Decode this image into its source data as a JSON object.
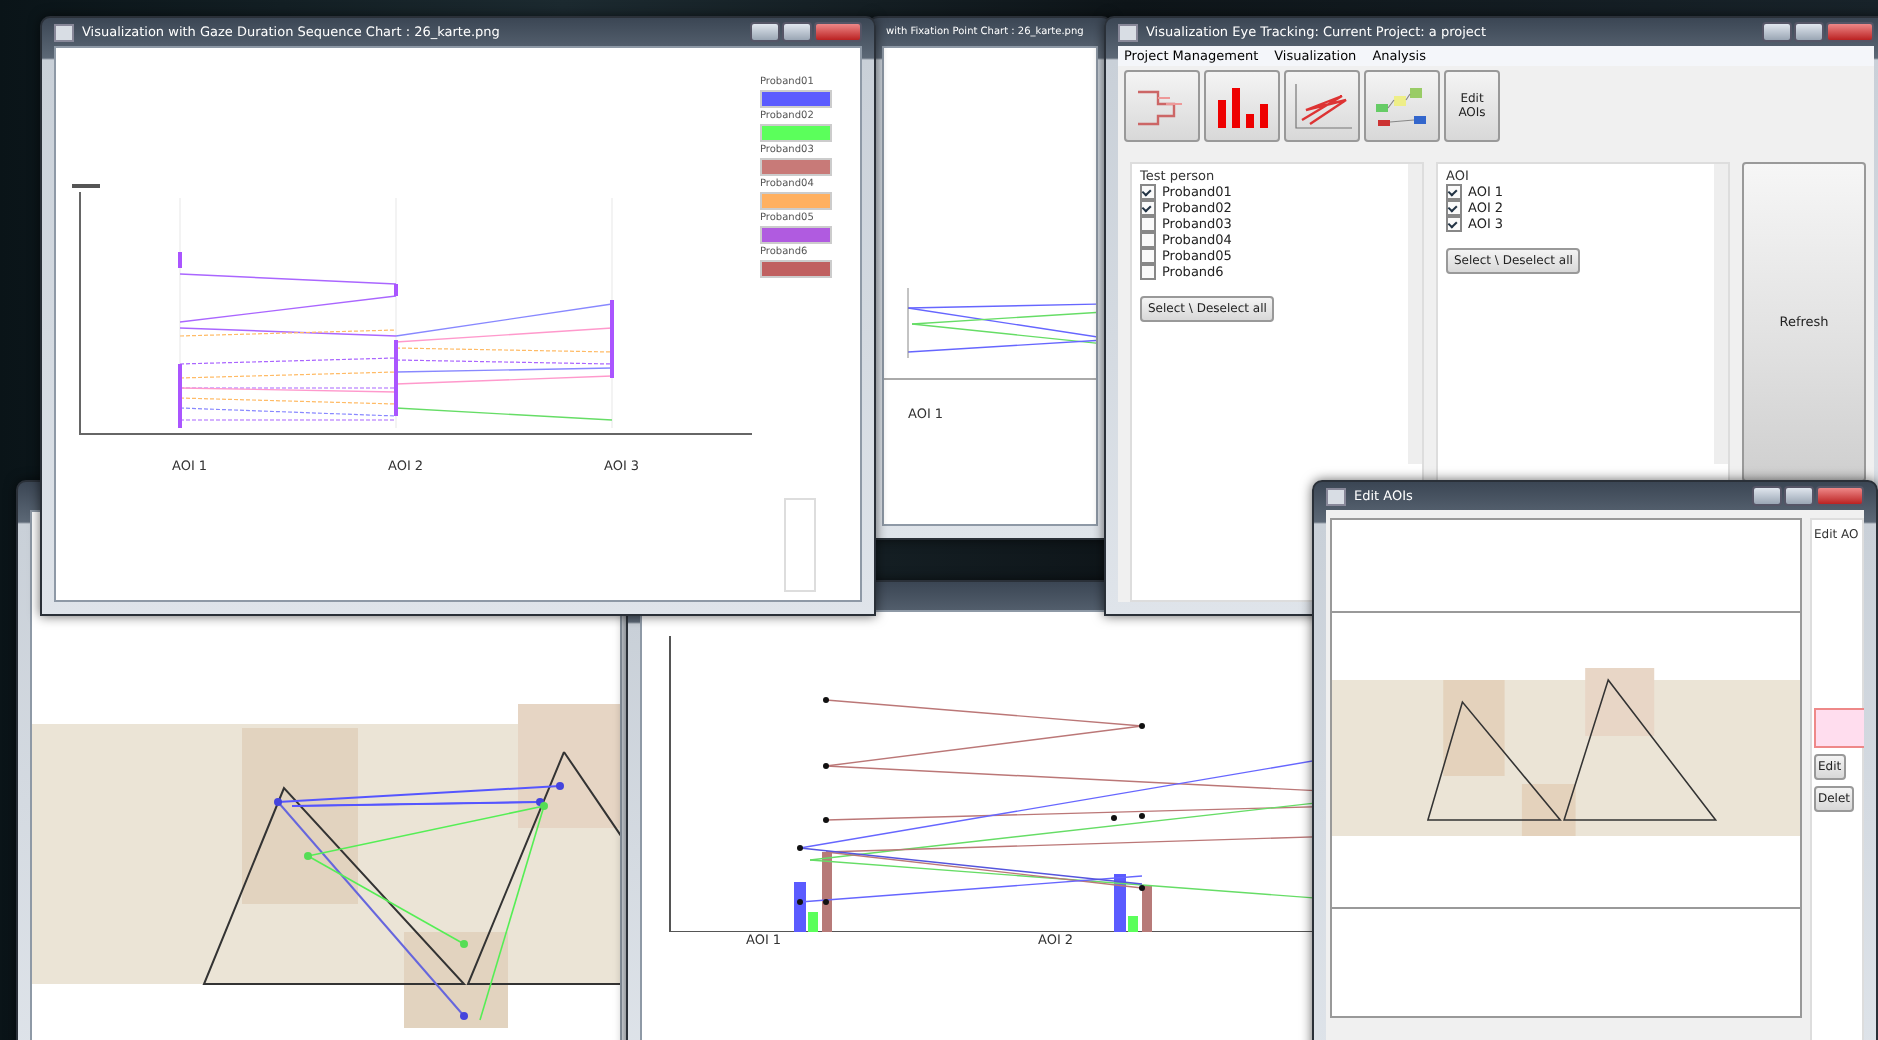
{
  "desktop": {
    "windows": [
      {
        "kind": "gaze_chart",
        "title": "Visualization with Gaze Duration Sequence Chart : 26_karte.png",
        "categories": [
          "AOI 1",
          "AOI 2",
          "AOI 3"
        ],
        "legend": [
          {
            "label": "Proband01",
            "color": "#5b5bff"
          },
          {
            "label": "Proband02",
            "color": "#5bff5b"
          },
          {
            "label": "Proband03",
            "color": "#c87a78"
          },
          {
            "label": "Proband04",
            "color": "#ffb060"
          },
          {
            "label": "Proband05",
            "color": "#b05be0"
          },
          {
            "label": "Proband6",
            "color": "#c06060"
          }
        ]
      },
      {
        "kind": "fixation_chart",
        "title": "with Fixation Point Chart : 26_karte.png",
        "categories": [
          "AOI 1"
        ]
      },
      {
        "kind": "main",
        "title": "Visualization Eye Tracking: Current Project: a project",
        "menu": [
          "Project Management",
          "Visualization",
          "Analysis"
        ],
        "toolbar_label": "Edit AOIs",
        "test_person": {
          "label": "Test person",
          "items": [
            {
              "label": "Proband01",
              "checked": true
            },
            {
              "label": "Proband02",
              "checked": true
            },
            {
              "label": "Proband03",
              "checked": false
            },
            {
              "label": "Proband04",
              "checked": false
            },
            {
              "label": "Proband05",
              "checked": false
            },
            {
              "label": "Proband6",
              "checked": false
            }
          ],
          "button": "Select \\ Deselect all"
        },
        "aoi": {
          "label": "AOI",
          "items": [
            {
              "label": "AOI 1",
              "checked": true
            },
            {
              "label": "AOI 2",
              "checked": true
            },
            {
              "label": "AOI 3",
              "checked": true
            }
          ],
          "button": "Select \\ Deselect all"
        },
        "refresh": "Refresh"
      },
      {
        "kind": "stimulus"
      },
      {
        "kind": "bar_chart",
        "categories": [
          "AOI 1",
          "AOI 2"
        ]
      },
      {
        "kind": "edit_aois",
        "title": "Edit AOIs",
        "side_label": "Edit AO",
        "buttons": [
          "Edit",
          "Delet"
        ]
      }
    ]
  }
}
